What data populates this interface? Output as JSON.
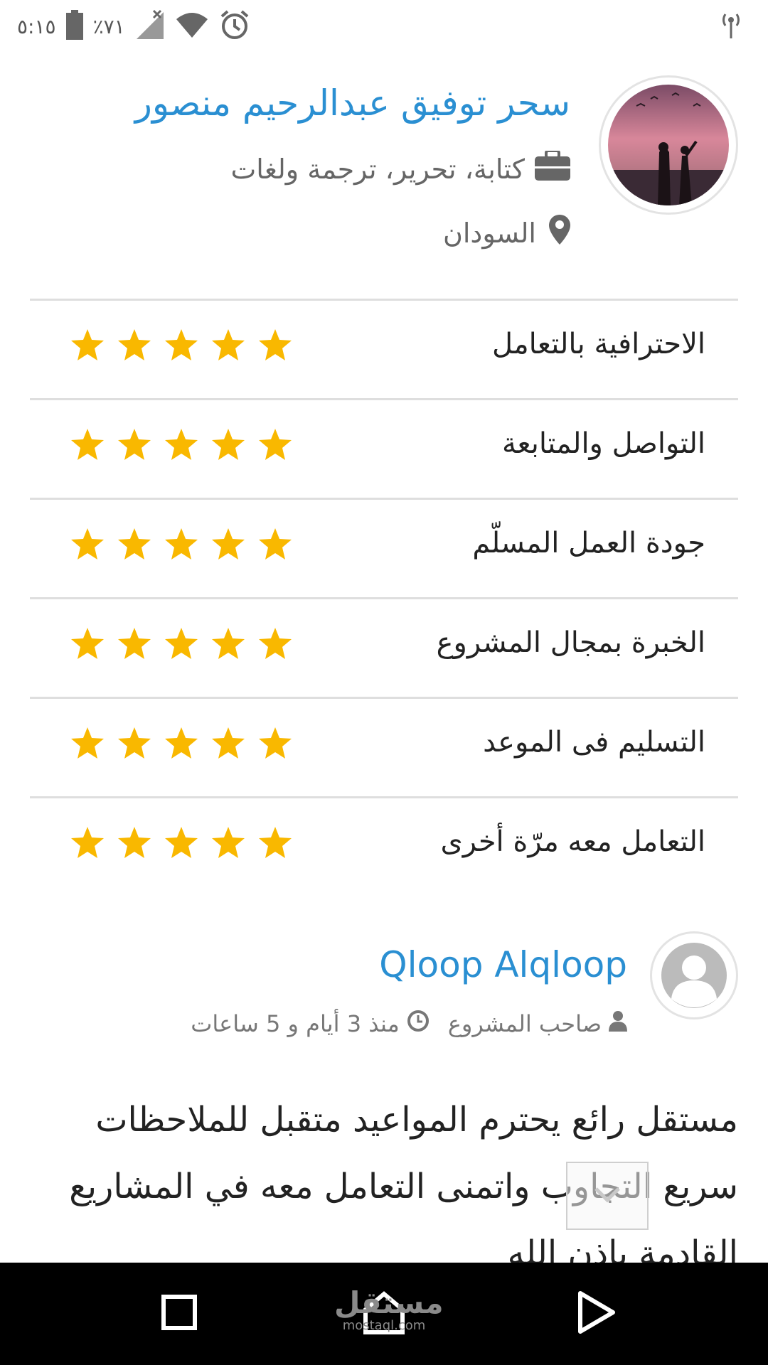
{
  "status_bar": {
    "time": "٥:١٥",
    "battery": "٪٧١",
    "icons": [
      "battery-icon",
      "signal-off-icon",
      "wifi-icon",
      "alarm-icon",
      "hotspot-icon"
    ]
  },
  "profile": {
    "name": "سحر توفيق عبدالرحيم منصور",
    "specialty": "كتابة، تحرير، ترجمة ولغات",
    "location": "السودان"
  },
  "ratings": [
    {
      "label": "الاحترافية بالتعامل",
      "stars": 5
    },
    {
      "label": "التواصل والمتابعة",
      "stars": 5
    },
    {
      "label": "جودة العمل المسلّم",
      "stars": 5
    },
    {
      "label": "الخبرة بمجال المشروع",
      "stars": 5
    },
    {
      "label": "التسليم فى الموعد",
      "stars": 5
    },
    {
      "label": "التعامل معه مرّة أخرى",
      "stars": 5
    }
  ],
  "reviewer": {
    "name": "Qloop Alqloop",
    "role": "صاحب المشروع",
    "time_ago": "منذ 3 أيام و 5 ساعات"
  },
  "comment": {
    "line1": "مستقل رائع يحترم المواعيد متقبل للملاحظات",
    "line2": "سريع التجاوب واتمنى التعامل معه في المشاريع",
    "line3": "القادمة بإذن الله"
  },
  "watermark": {
    "ar": "مستقل",
    "en": "mostaql.com"
  },
  "colors": {
    "accent": "#2a8fd2",
    "star": "#f9b800",
    "divider": "#dedede"
  }
}
